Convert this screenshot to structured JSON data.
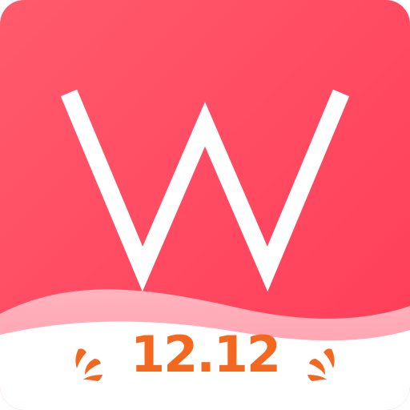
{
  "icon": {
    "name": "W app icon",
    "logo_letter": "W",
    "promo_text": "12.12",
    "colors": {
      "background_top": "#ff5a6e",
      "background_bottom": "#ff3f58",
      "wave_pink": "#ffa9b4",
      "footer": "#ffffff",
      "promo_orange": "#f4671f",
      "logo": "#ffffff"
    },
    "decorations": [
      "left-fireworks-icon",
      "right-fireworks-icon"
    ]
  }
}
